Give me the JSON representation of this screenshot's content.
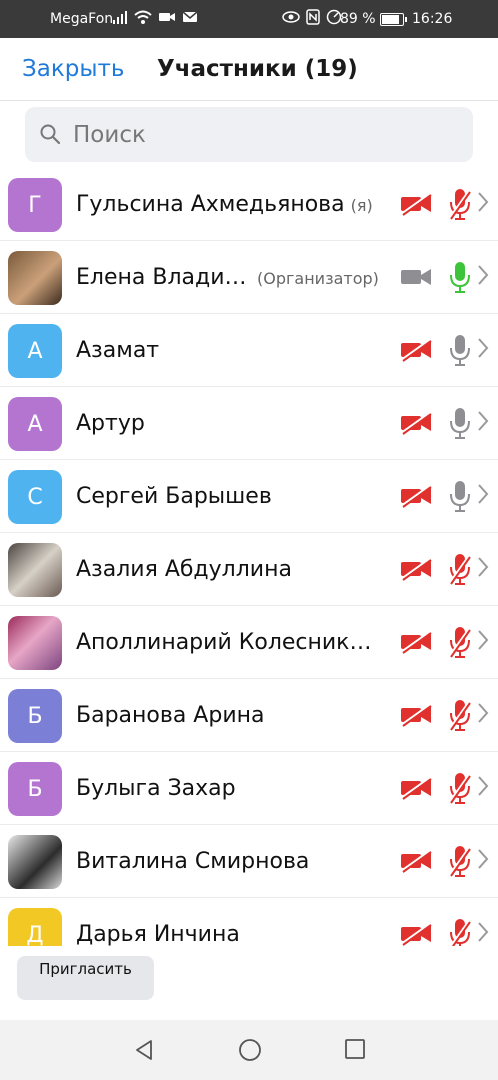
{
  "status_bar": {
    "carrier": "MegaFon",
    "battery": "89 %",
    "battery_level": 0.89,
    "time": "16:26",
    "icons": [
      "signal-icon",
      "wifi-icon",
      "video-icon",
      "mail-icon",
      "eye-icon",
      "nfc-icon",
      "data-saver-icon",
      "battery-icon"
    ]
  },
  "header": {
    "close_label": "Закрыть",
    "title": "Участники (19)"
  },
  "search": {
    "placeholder": "Поиск",
    "value": ""
  },
  "participants": [
    {
      "initial": "Г",
      "name": "Гульсина Ахмедьянова",
      "suffix": "(я)",
      "role": "",
      "avatar_color": "#b475d1",
      "photo": false,
      "camera": "off",
      "mic": "muted"
    },
    {
      "initial": "",
      "name": "Елена Влади…",
      "suffix": "",
      "role": "(Организатор)",
      "avatar_color": "",
      "photo": true,
      "camera": "on",
      "mic": "active"
    },
    {
      "initial": "А",
      "name": "Азамат",
      "suffix": "",
      "role": "",
      "avatar_color": "#4fb3f0",
      "photo": false,
      "camera": "off",
      "mic": "idle"
    },
    {
      "initial": "А",
      "name": "Артур",
      "suffix": "",
      "role": "",
      "avatar_color": "#b475d1",
      "photo": false,
      "camera": "off",
      "mic": "idle"
    },
    {
      "initial": "С",
      "name": "Сергей Барышев",
      "suffix": "",
      "role": "",
      "avatar_color": "#4fb3f0",
      "photo": false,
      "camera": "off",
      "mic": "idle"
    },
    {
      "initial": "",
      "name": "Азалия Абдуллина",
      "suffix": "",
      "role": "",
      "avatar_color": "",
      "photo": true,
      "camera": "off",
      "mic": "muted"
    },
    {
      "initial": "",
      "name": "Аполлинарий Колесник…",
      "suffix": "",
      "role": "",
      "avatar_color": "",
      "photo": true,
      "camera": "off",
      "mic": "muted"
    },
    {
      "initial": "Б",
      "name": "Баранова Арина",
      "suffix": "",
      "role": "",
      "avatar_color": "#7b7fd6",
      "photo": false,
      "camera": "off",
      "mic": "muted"
    },
    {
      "initial": "Б",
      "name": "Булыга Захар",
      "suffix": "",
      "role": "",
      "avatar_color": "#b475d1",
      "photo": false,
      "camera": "off",
      "mic": "muted"
    },
    {
      "initial": "",
      "name": "Виталина Смирнова",
      "suffix": "",
      "role": "",
      "avatar_color": "",
      "photo": true,
      "camera": "off",
      "mic": "muted"
    },
    {
      "initial": "Д",
      "name": "Дарья Инчина",
      "suffix": "",
      "role": "",
      "avatar_color": "#f2c824",
      "photo": false,
      "camera": "off",
      "mic": "muted"
    }
  ],
  "footer": {
    "invite_label": "Пригласить"
  },
  "colors": {
    "accent": "#1f7ad9",
    "muted_red": "#e0312e",
    "active_green": "#3ec43a",
    "idle_gray": "#8e8e93"
  }
}
